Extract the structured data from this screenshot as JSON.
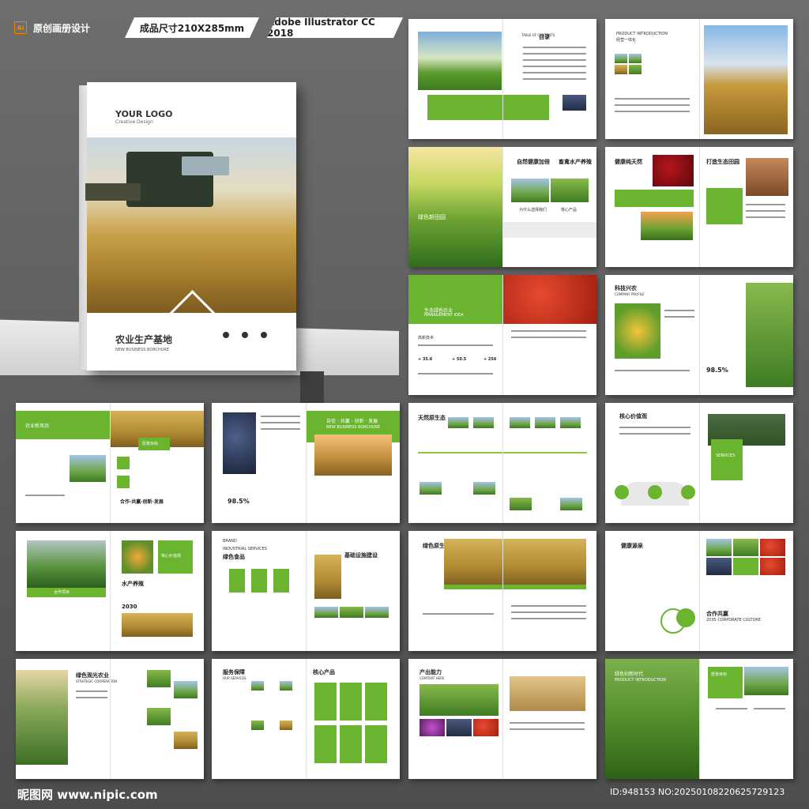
{
  "header": {
    "ai_badge": "Ai",
    "title": "原创画册设计",
    "size": "成品尺寸210X285mm",
    "software": "Adobe Illustrator CC 2018"
  },
  "cover": {
    "logo": "YOUR LOGO",
    "logo_sub": "Creative Design",
    "title": "农业生产基地",
    "subtitle": "NEW BUSINESS BORCHURE"
  },
  "spreads": {
    "s1": {
      "title": "目录",
      "sub": "TABLE OF CONTENTS"
    },
    "s2": {
      "title": "PRODUCT INTRODUCTION",
      "sub": "经营一体化"
    },
    "s3": {
      "a": "自然健康加倍",
      "b": "畜禽水产养殖",
      "c": "绿色新田园",
      "d": "为什么选择我们",
      "e": "核心产品"
    },
    "s4": {
      "a": "健康纯天然",
      "b": "打造生态田园"
    },
    "s5": {
      "a": "生态绿色农业",
      "b": "MANAGEMENT IDEA",
      "c": "高新技术",
      "v1": "+ 35.6",
      "v2": "+ 50.5",
      "v3": "+ 256"
    },
    "s6": {
      "a": "科技兴农",
      "b": "COMPANY PROFILE",
      "c": "科技兴农",
      "pct": "98.5%"
    },
    "s7": {
      "a": "农业新风尚",
      "b": "愿景目标",
      "c": "合作·共赢·创新·发展"
    },
    "s8": {
      "a": "自信 · 共赢 · 创新 · 发展",
      "b": "NEW BUSINESS BORCHURE",
      "pct": "98.5%"
    },
    "s9": {
      "a": "天然原生态"
    },
    "s10": {
      "a": "核心价值观",
      "b": "SERVICES"
    },
    "s11": {
      "a": "核心价值观",
      "b": "水产养殖",
      "c": "2030",
      "d": "合作项目"
    },
    "s12": {
      "a": "BRAND",
      "b": "INDUSTRIAL SERVICES",
      "c": "绿色食品",
      "d": "基础设施建设"
    },
    "s13": {
      "a": "绿色原生态"
    },
    "s14": {
      "a": "健康源泉",
      "b": "合作共赢",
      "c": "2035 CORPORATE CULTURE"
    },
    "s15": {
      "a": "绿色观光农业",
      "b": "STRATEGIC COOPERATION"
    },
    "s16": {
      "a": "服务保障",
      "b": "OUR SERVICES",
      "c": "核心产品"
    },
    "s17": {
      "a": "产出能力",
      "b": "CONTENT HERE"
    },
    "s18": {
      "a": "绿色创新时代",
      "b": "PRODUCT INTRODUCTION",
      "c": "愿景目标"
    }
  },
  "footer": {
    "site": "昵图网 www.nipic.com",
    "id": "ID:948153 NO:20250108220625729123"
  },
  "colors": {
    "accent": "#6ab42f",
    "light_accent": "#8cc63f"
  }
}
